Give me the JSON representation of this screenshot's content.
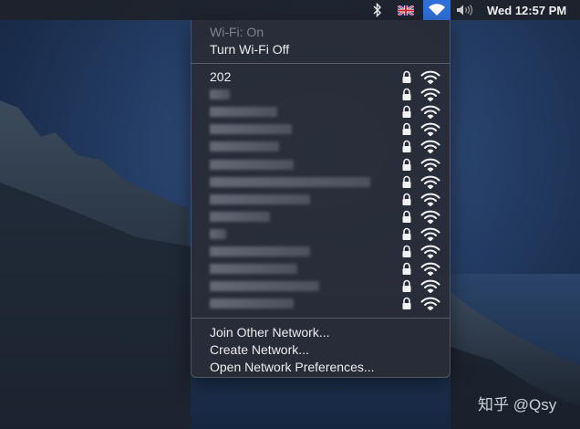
{
  "menubar": {
    "bluetooth_icon": "bluetooth-icon",
    "input_icon": "uk-flag-icon",
    "wifi_icon": "wifi-icon",
    "volume_icon": "volume-icon",
    "clock": "Wed 12:57 PM",
    "wifi_highlight_color": "#2f6fd8"
  },
  "wifi_menu": {
    "status": "Wi-Fi: On",
    "toggle_label": "Turn Wi-Fi Off",
    "networks": [
      {
        "name": "202",
        "secured": true,
        "strength": 3
      },
      {
        "name": "",
        "obscured": true,
        "secured": true,
        "strength": 3
      },
      {
        "name": "",
        "obscured": true,
        "secured": true,
        "strength": 3
      },
      {
        "name": "",
        "obscured": true,
        "secured": true,
        "strength": 3
      },
      {
        "name": "",
        "obscured": true,
        "secured": true,
        "strength": 3
      },
      {
        "name": "",
        "obscured": true,
        "secured": true,
        "strength": 3
      },
      {
        "name": "",
        "obscured": true,
        "secured": true,
        "strength": 3
      },
      {
        "name": "",
        "obscured": true,
        "secured": true,
        "strength": 3
      },
      {
        "name": "",
        "obscured": true,
        "secured": true,
        "strength": 3
      },
      {
        "name": "",
        "obscured": true,
        "secured": true,
        "strength": 3
      },
      {
        "name": "",
        "obscured": true,
        "secured": true,
        "strength": 3
      },
      {
        "name": "",
        "obscured": true,
        "secured": true,
        "strength": 3
      },
      {
        "name": "",
        "obscured": true,
        "secured": true,
        "strength": 3
      },
      {
        "name": "",
        "obscured": true,
        "secured": true,
        "strength": 3
      }
    ],
    "actions": {
      "join": "Join Other Network...",
      "create": "Create Network...",
      "preferences": "Open Network Preferences..."
    }
  },
  "watermark": "知乎 @Qsy"
}
